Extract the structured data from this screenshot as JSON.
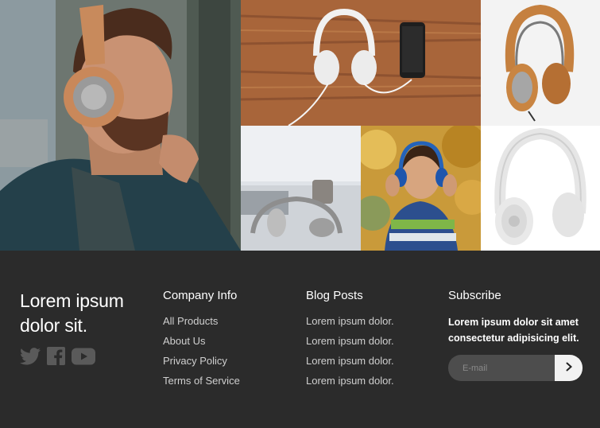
{
  "gallery": {
    "images": [
      {
        "name": "man-with-headphones"
      },
      {
        "name": "headphones-on-wooden-desk"
      },
      {
        "name": "brown-headphones"
      },
      {
        "name": "headphones-on-laptop-desk"
      },
      {
        "name": "boy-with-headphones"
      },
      {
        "name": "white-headphones"
      }
    ]
  },
  "footer": {
    "brand_title": "Lorem ipsum dolor sit.",
    "social": [
      {
        "icon": "twitter-icon"
      },
      {
        "icon": "facebook-icon"
      },
      {
        "icon": "youtube-icon"
      }
    ],
    "company": {
      "title": "Company Info",
      "links": [
        "All Products",
        "About Us",
        "Privacy Policy",
        "Terms of Service"
      ]
    },
    "blog": {
      "title": "Blog Posts",
      "links": [
        "Lorem ipsum dolor.",
        "Lorem ipsum dolor.",
        "Lorem ipsum dolor.",
        "Lorem ipsum dolor."
      ]
    },
    "subscribe": {
      "title": "Subscribe",
      "text": "Lorem ipsum dolor sit amet consectetur adipisicing elit.",
      "placeholder": "E-mail",
      "button_icon": "chevron-right-icon"
    }
  },
  "colors": {
    "footer_bg": "#2b2b2b",
    "input_bg": "#4d4d4d",
    "icon_gray": "#5a5a5a",
    "link_text": "#cfcfcf"
  }
}
